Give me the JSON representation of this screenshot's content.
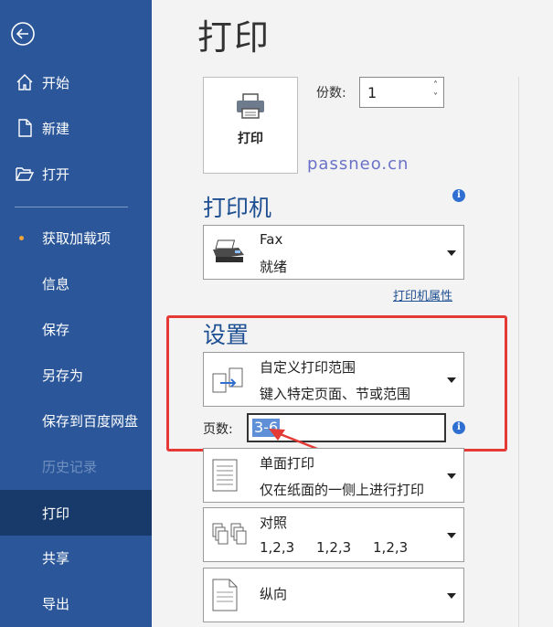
{
  "sidebar": {
    "items": [
      {
        "label": "开始",
        "icon": "home-icon"
      },
      {
        "label": "新建",
        "icon": "new-document-icon"
      },
      {
        "label": "打开",
        "icon": "open-folder-icon"
      },
      {
        "label": "获取加载项",
        "icon": "bullet-dot"
      },
      {
        "label": "信息"
      },
      {
        "label": "保存"
      },
      {
        "label": "另存为"
      },
      {
        "label": "保存到百度网盘"
      },
      {
        "label": "历史记录",
        "disabled": true
      },
      {
        "label": "打印",
        "active": true
      },
      {
        "label": "共享"
      },
      {
        "label": "导出"
      }
    ]
  },
  "page": {
    "title": "打印"
  },
  "print_button": {
    "label": "打印",
    "icon": "printer-icon"
  },
  "copies": {
    "label": "份数:",
    "value": "1"
  },
  "watermark": "passneo.cn",
  "printer": {
    "section_title": "打印机",
    "name": "Fax",
    "status": "就绪",
    "properties_link": "打印机属性",
    "icon": "fax-icon"
  },
  "settings": {
    "section_title": "设置",
    "range": {
      "title": "自定义打印范围",
      "subtitle": "键入特定页面、节或范围"
    },
    "pages": {
      "label": "页数:",
      "value": "3-6"
    },
    "sides": {
      "title": "单面打印",
      "subtitle": "仅在纸面的一侧上进行打印"
    },
    "collation": {
      "title": "对照",
      "subtitle": "1,2,3     1,2,3     1,2,3"
    },
    "orientation": {
      "title": "纵向"
    }
  },
  "colors": {
    "sidebar": "#2b579a",
    "active": "#173a6a",
    "accent": "#1e4f92",
    "highlight": "#e53935"
  }
}
